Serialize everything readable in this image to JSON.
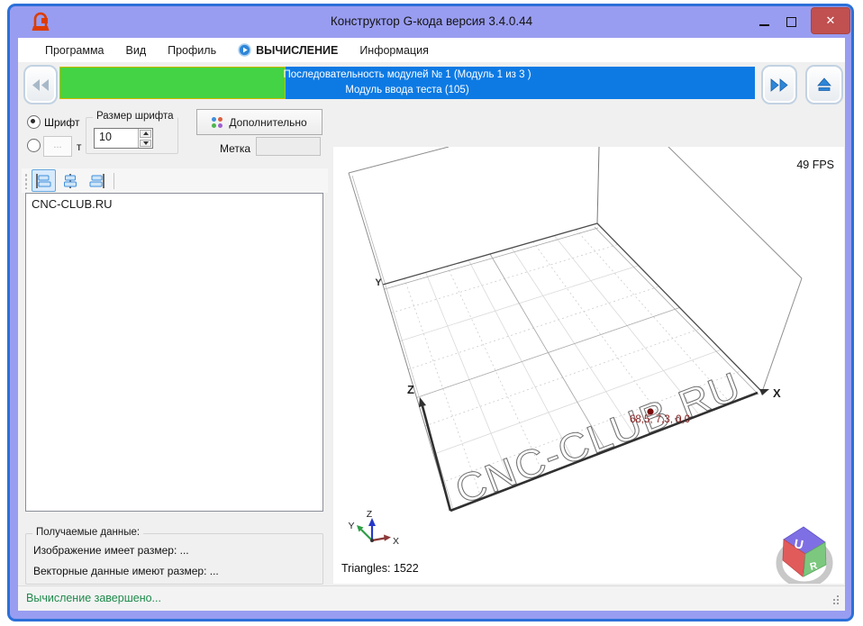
{
  "window": {
    "title": "Конструктор G-кода версия 3.4.0.44",
    "close_glyph": "✕"
  },
  "menu": {
    "items": [
      "Программа",
      "Вид",
      "Профиль",
      "ВЫЧИСЛЕНИЕ",
      "Информация"
    ]
  },
  "toolbar": {
    "progress_line1": "Последовательность модулей № 1 (Модуль 1 из 3 )",
    "progress_line2": "Модуль ввода теста (105)",
    "progress_green_color": "#44d344",
    "progress_blue_color": "#0d7ae4"
  },
  "left_panel": {
    "font_radio_label": "Шрифт",
    "font_size_group_title": "Размер шрифта",
    "font_size_value": "10",
    "ellipsis_button_label": "...",
    "text_radio_label": "т",
    "advanced_button_label": "Дополнительно",
    "mark_label": "Метка",
    "mark_field_value": "",
    "editor_text": "CNC-CLUB.RU"
  },
  "data_group": {
    "title": "Получаемые данные:",
    "image_size_line": "Изображение имеет размер:  ...",
    "vector_size_line": "Векторные данные имеют размер:  ..."
  },
  "status_bar": {
    "message": "Вычисление завершено...",
    "message_color": "#1f8a4c"
  },
  "viewport": {
    "fps_label": "49 FPS",
    "triangles_label": "Triangles: 1522",
    "cursor_coords": "68,5, 7,3, 0,0",
    "coords_color": "#8b1c1c",
    "watermark_text": "CNC-CLUB.RU",
    "axis_labels": {
      "x": "X",
      "y": "Y",
      "z": "Z"
    },
    "gizmo_labels": {
      "x": "X",
      "y": "Y",
      "z": "Z"
    },
    "logo": {
      "top_letter": "U",
      "right_letter": "R"
    }
  },
  "icons": {
    "app": "cnc-machine-icon",
    "calc_menu": "play-circle-icon",
    "nav_back": "double-left-arrow-icon",
    "nav_forward": "double-right-arrow-icon",
    "nav_eject": "eject-icon",
    "advanced": "colored-dots-icon",
    "align_buttons": [
      "align-left-icon",
      "align-center-icon",
      "align-right-icon"
    ]
  }
}
